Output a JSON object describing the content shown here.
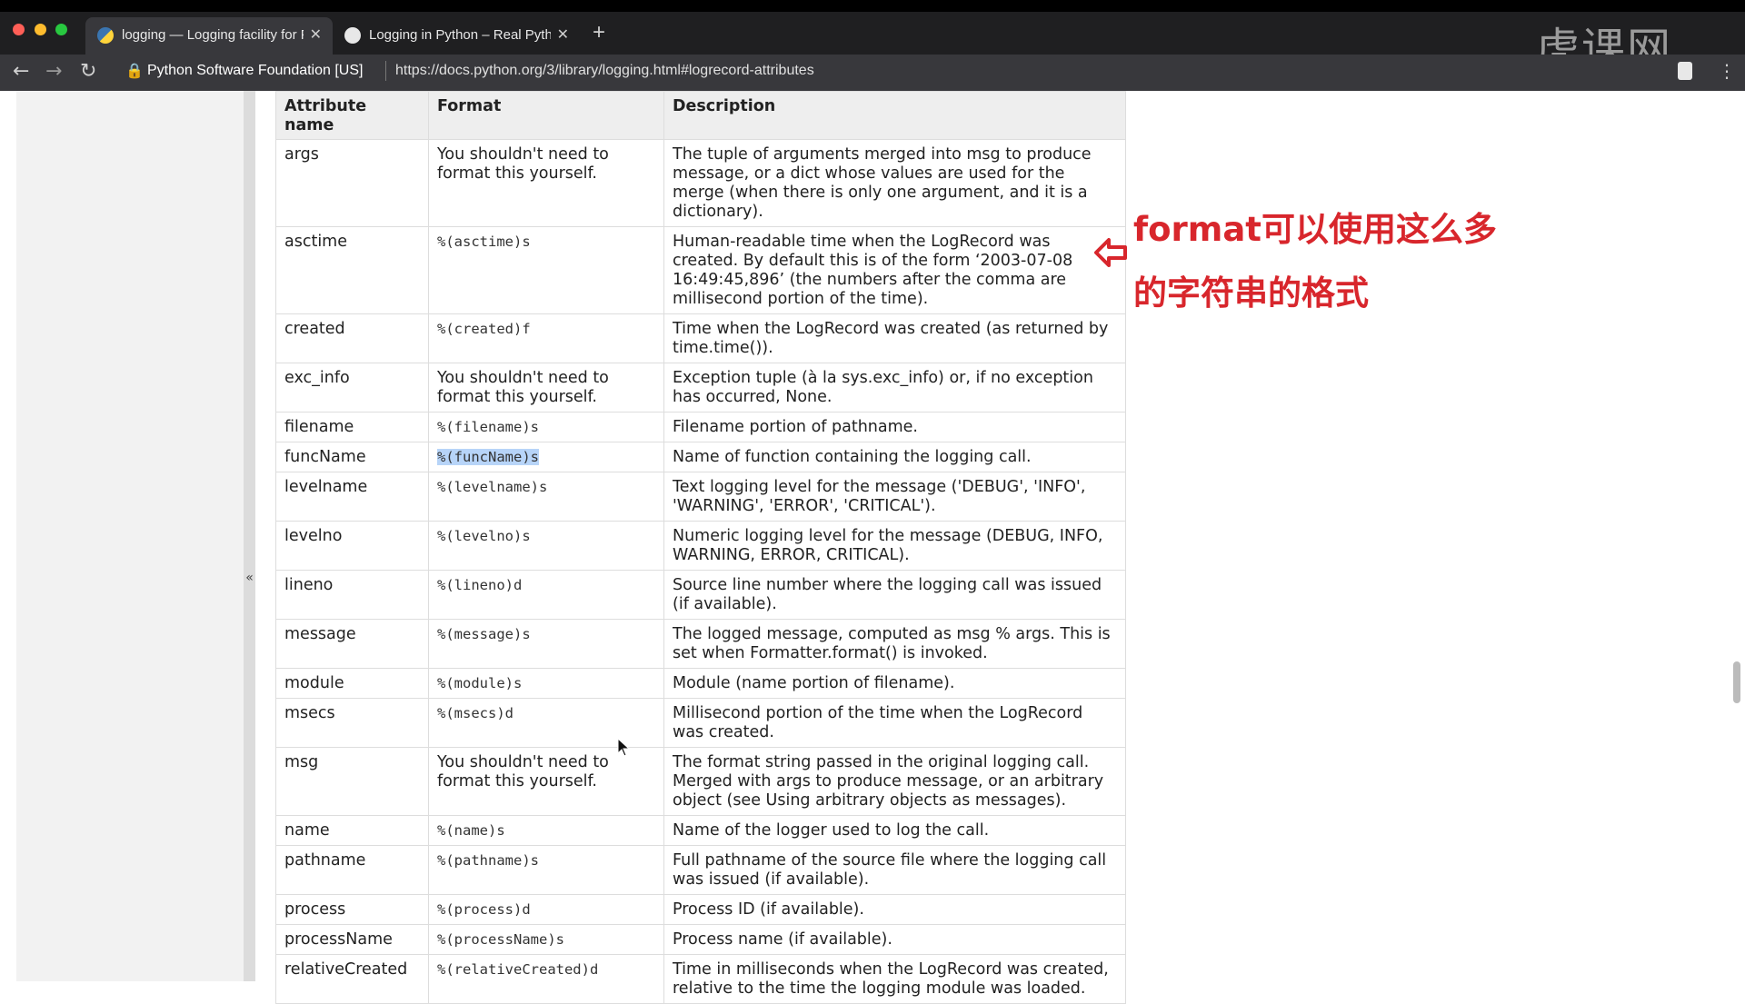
{
  "browser": {
    "tabs": [
      {
        "title": "logging — Logging facility for P",
        "active": true,
        "favicon": "python-icon"
      },
      {
        "title": "Logging in Python – Real Pytho",
        "active": false,
        "favicon": "realpython-icon"
      }
    ],
    "site_identity": "Python Software Foundation [US]",
    "url": "https://docs.python.org/3/library/logging.html#logrecord-attributes",
    "watermark": "虎课网"
  },
  "sidebar": {
    "collapse_label": "«"
  },
  "table": {
    "headers": [
      "Attribute name",
      "Format",
      "Description"
    ],
    "rows": [
      {
        "name": "args",
        "format": "",
        "format_text": "You shouldn't need to format this yourself.",
        "desc": "The tuple of arguments merged into msg to produce message, or a dict whose values are used for the merge (when there is only one argument, and it is a dictionary)."
      },
      {
        "name": "asctime",
        "format": "%(asctime)s",
        "desc": "Human-readable time when the LogRecord was created. By default this is of the form ‘2003-07-08 16:49:45,896’ (the numbers after the comma are millisecond portion of the time)."
      },
      {
        "name": "created",
        "format": "%(created)f",
        "desc": "Time when the LogRecord was created (as returned by time.time())."
      },
      {
        "name": "exc_info",
        "format": "",
        "format_text": "You shouldn't need to format this yourself.",
        "desc": "Exception tuple (à la sys.exc_info) or, if no exception has occurred, None."
      },
      {
        "name": "filename",
        "format": "%(filename)s",
        "desc": "Filename portion of pathname."
      },
      {
        "name": "funcName",
        "format": "%(funcName)s",
        "highlight": true,
        "desc": "Name of function containing the logging call."
      },
      {
        "name": "levelname",
        "format": "%(levelname)s",
        "desc": "Text logging level for the message ('DEBUG', 'INFO', 'WARNING', 'ERROR', 'CRITICAL')."
      },
      {
        "name": "levelno",
        "format": "%(levelno)s",
        "desc": "Numeric logging level for the message (DEBUG, INFO, WARNING, ERROR, CRITICAL)."
      },
      {
        "name": "lineno",
        "format": "%(lineno)d",
        "desc": "Source line number where the logging call was issued (if available)."
      },
      {
        "name": "message",
        "format": "%(message)s",
        "desc": "The logged message, computed as msg % args. This is set when Formatter.format() is invoked."
      },
      {
        "name": "module",
        "format": "%(module)s",
        "desc": "Module (name portion of filename)."
      },
      {
        "name": "msecs",
        "format": "%(msecs)d",
        "desc": "Millisecond portion of the time when the LogRecord was created."
      },
      {
        "name": "msg",
        "format": "",
        "format_text": "You shouldn't need to format this yourself.",
        "desc": "The format string passed in the original logging call. Merged with args to produce message, or an arbitrary object (see Using arbitrary objects as messages)."
      },
      {
        "name": "name",
        "format": "%(name)s",
        "desc": "Name of the logger used to log the call."
      },
      {
        "name": "pathname",
        "format": "%(pathname)s",
        "desc": "Full pathname of the source file where the logging call was issued (if available)."
      },
      {
        "name": "process",
        "format": "%(process)d",
        "desc": "Process ID (if available)."
      },
      {
        "name": "processName",
        "format": "%(processName)s",
        "desc": "Process name (if available)."
      },
      {
        "name": "relativeCreated",
        "format": "%(relativeCreated)d",
        "desc": "Time in milliseconds when the LogRecord was created, relative to the time the logging module was loaded."
      }
    ]
  },
  "annotation": {
    "line1": "format可以使用这么多",
    "line2": "的字符串的格式",
    "color": "#d8262c"
  }
}
